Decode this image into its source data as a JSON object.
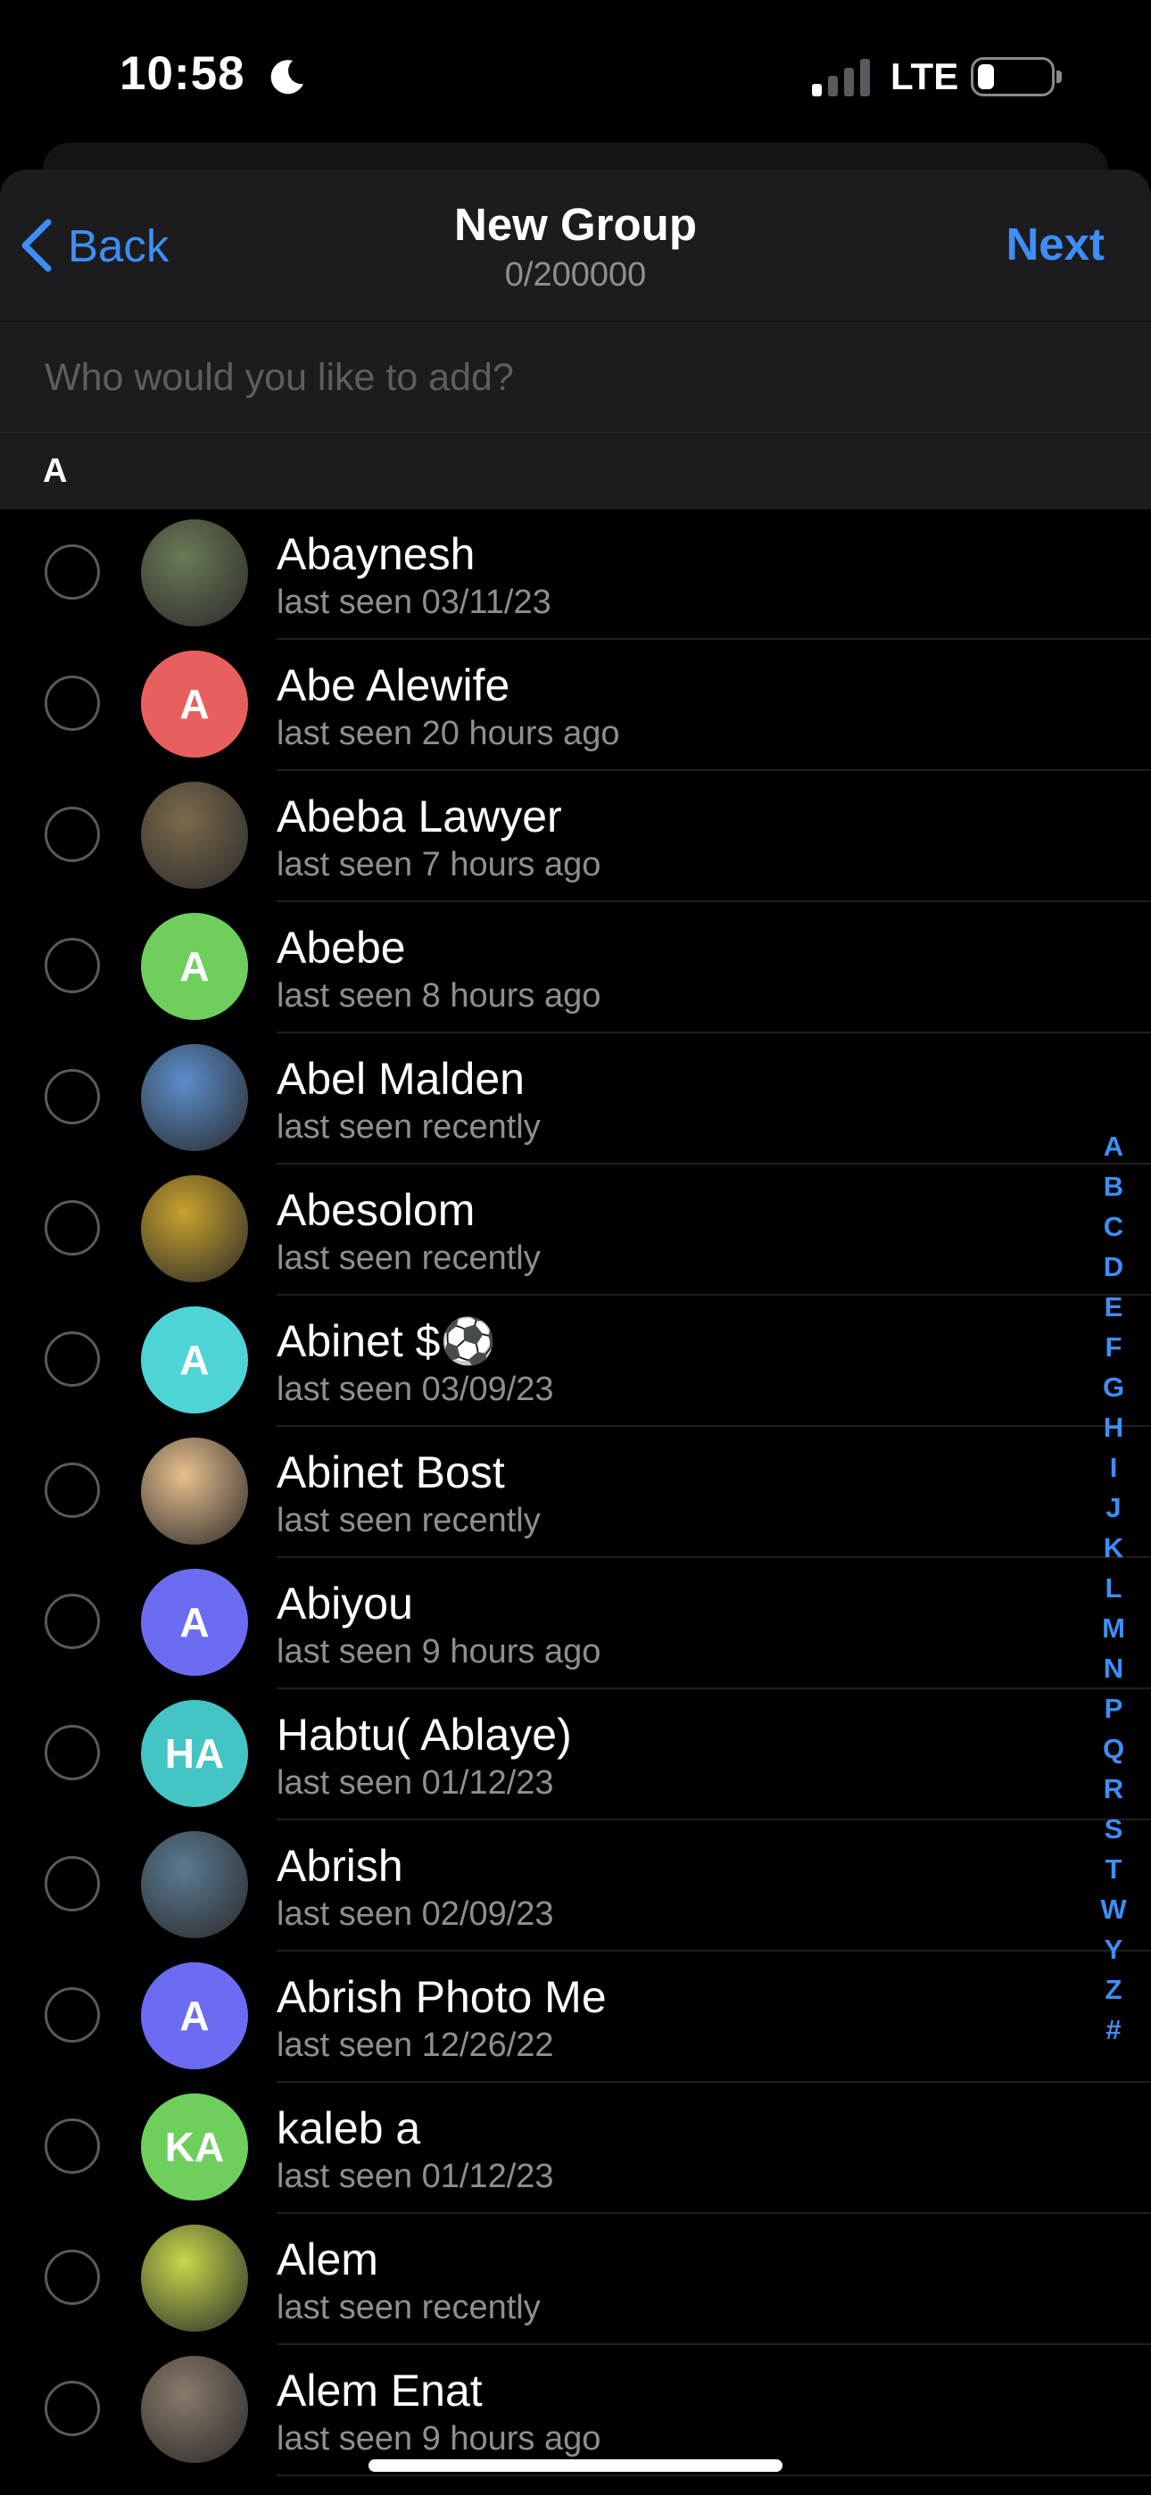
{
  "status_bar": {
    "time": "10:58",
    "network": "LTE"
  },
  "nav": {
    "back_label": "Back",
    "title": "New Group",
    "subtitle": "0/200000",
    "next_label": "Next"
  },
  "search": {
    "placeholder": "Who would you like to add?"
  },
  "section": {
    "letter": "A"
  },
  "contacts": [
    {
      "name": "Abaynesh",
      "status": "last seen 03/11/23",
      "initials": "",
      "color": "#6b7a56"
    },
    {
      "name": "Abe Alewife",
      "status": "last seen 20 hours ago",
      "initials": "A",
      "color": "#e8605d"
    },
    {
      "name": "Abeba Lawyer",
      "status": "last seen 7 hours ago",
      "initials": "",
      "color": "#7c6a4c"
    },
    {
      "name": "Abebe",
      "status": "last seen 8 hours ago",
      "initials": "A",
      "color": "#6fcf5d"
    },
    {
      "name": "Abel Malden",
      "status": "last seen recently",
      "initials": "",
      "color": "#5b8ecb"
    },
    {
      "name": "Abesolom",
      "status": "last seen recently",
      "initials": "",
      "color": "#c9a22c"
    },
    {
      "name": "Abinet $⚽",
      "status": "last seen 03/09/23",
      "initials": "A",
      "color": "#4fd4d6"
    },
    {
      "name": "Abinet Bost",
      "status": "last seen recently",
      "initials": "",
      "color": "#e8c08e"
    },
    {
      "name": "Abiyou",
      "status": "last seen 9 hours ago",
      "initials": "A",
      "color": "#6b6cf1"
    },
    {
      "name": "Habtu( Ablaye)",
      "status": "last seen 01/12/23",
      "initials": "HA",
      "color": "#44c4c4"
    },
    {
      "name": "Abrish",
      "status": "last seen 02/09/23",
      "initials": "",
      "color": "#5a7a92"
    },
    {
      "name": "Abrish Photo Me",
      "status": "last seen 12/26/22",
      "initials": "A",
      "color": "#6b6cf1"
    },
    {
      "name": "kaleb a",
      "status": "last seen 01/12/23",
      "initials": "KA",
      "color": "#6fcf5d"
    },
    {
      "name": "Alem",
      "status": "last seen recently",
      "initials": "",
      "color": "#c8d84a"
    },
    {
      "name": "Alem Enat",
      "status": "last seen 9 hours ago",
      "initials": "",
      "color": "#8a7a6a"
    }
  ],
  "index_letters": [
    "A",
    "B",
    "C",
    "D",
    "E",
    "F",
    "G",
    "H",
    "I",
    "J",
    "K",
    "L",
    "M",
    "N",
    "P",
    "Q",
    "R",
    "S",
    "T",
    "W",
    "Y",
    "Z",
    "#"
  ]
}
